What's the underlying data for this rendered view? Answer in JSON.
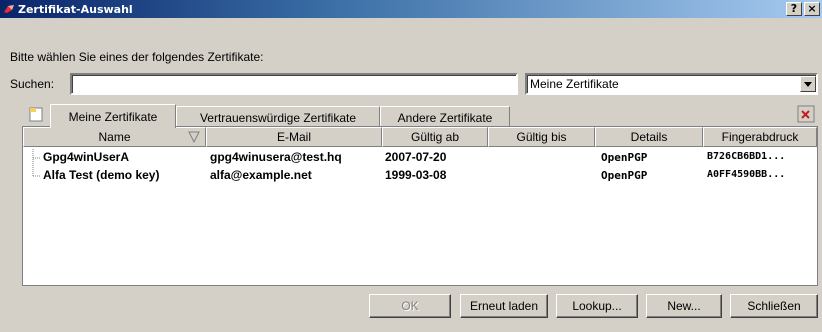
{
  "window": {
    "title": "Zertifikat-Auswahl",
    "help_button": "?",
    "close_button": "×"
  },
  "prompt": "Bitte wählen Sie eines der folgendes Zertifikate:",
  "search": {
    "label": "Suchen:",
    "value": "",
    "filter_selected": "Meine Zertifikate"
  },
  "tabs": [
    {
      "label": "Meine Zertifikate",
      "active": true
    },
    {
      "label": "Vertrauenswürdige Zertifikate",
      "active": false
    },
    {
      "label": "Andere Zertifikate",
      "active": false
    }
  ],
  "table": {
    "columns": [
      "Name",
      "E-Mail",
      "Gültig ab",
      "Gültig bis",
      "Details",
      "Fingerabdruck"
    ],
    "rows": [
      {
        "name": "Gpg4winUserA",
        "email": "gpg4winusera@test.hq",
        "valid_from": "2007-07-20",
        "valid_to": "",
        "details": "OpenPGP",
        "fingerprint": "B726CB6BD1..."
      },
      {
        "name": "Alfa Test (demo key)",
        "email": "alfa@example.net",
        "valid_from": "1999-03-08",
        "valid_to": "",
        "details": "OpenPGP",
        "fingerprint": "A0FF4590BB..."
      }
    ]
  },
  "buttons": {
    "ok": "OK",
    "reload": "Erneut laden",
    "lookup": "Lookup...",
    "new": "New...",
    "close": "Schließen"
  }
}
